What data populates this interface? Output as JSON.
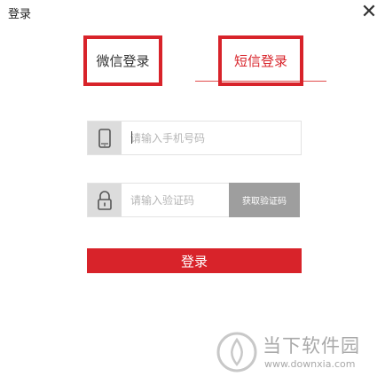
{
  "window": {
    "title": "登录",
    "close_label": "✕"
  },
  "tabs": {
    "wechat_label": "微信登录",
    "sms_label": "短信登录"
  },
  "phone": {
    "placeholder": "请输入手机号码",
    "icon": "mobile-phone-icon"
  },
  "code": {
    "placeholder": "请输入验证码",
    "icon": "lock-icon",
    "get_code_label": "获取验证码"
  },
  "login": {
    "label": "登录"
  },
  "watermark": {
    "name": "当下软件园",
    "url": "www.downxia.com"
  },
  "colors": {
    "accent": "#d8232a",
    "get_code_bg": "#9e9e9e",
    "icon_bg": "#dcdcdc"
  }
}
